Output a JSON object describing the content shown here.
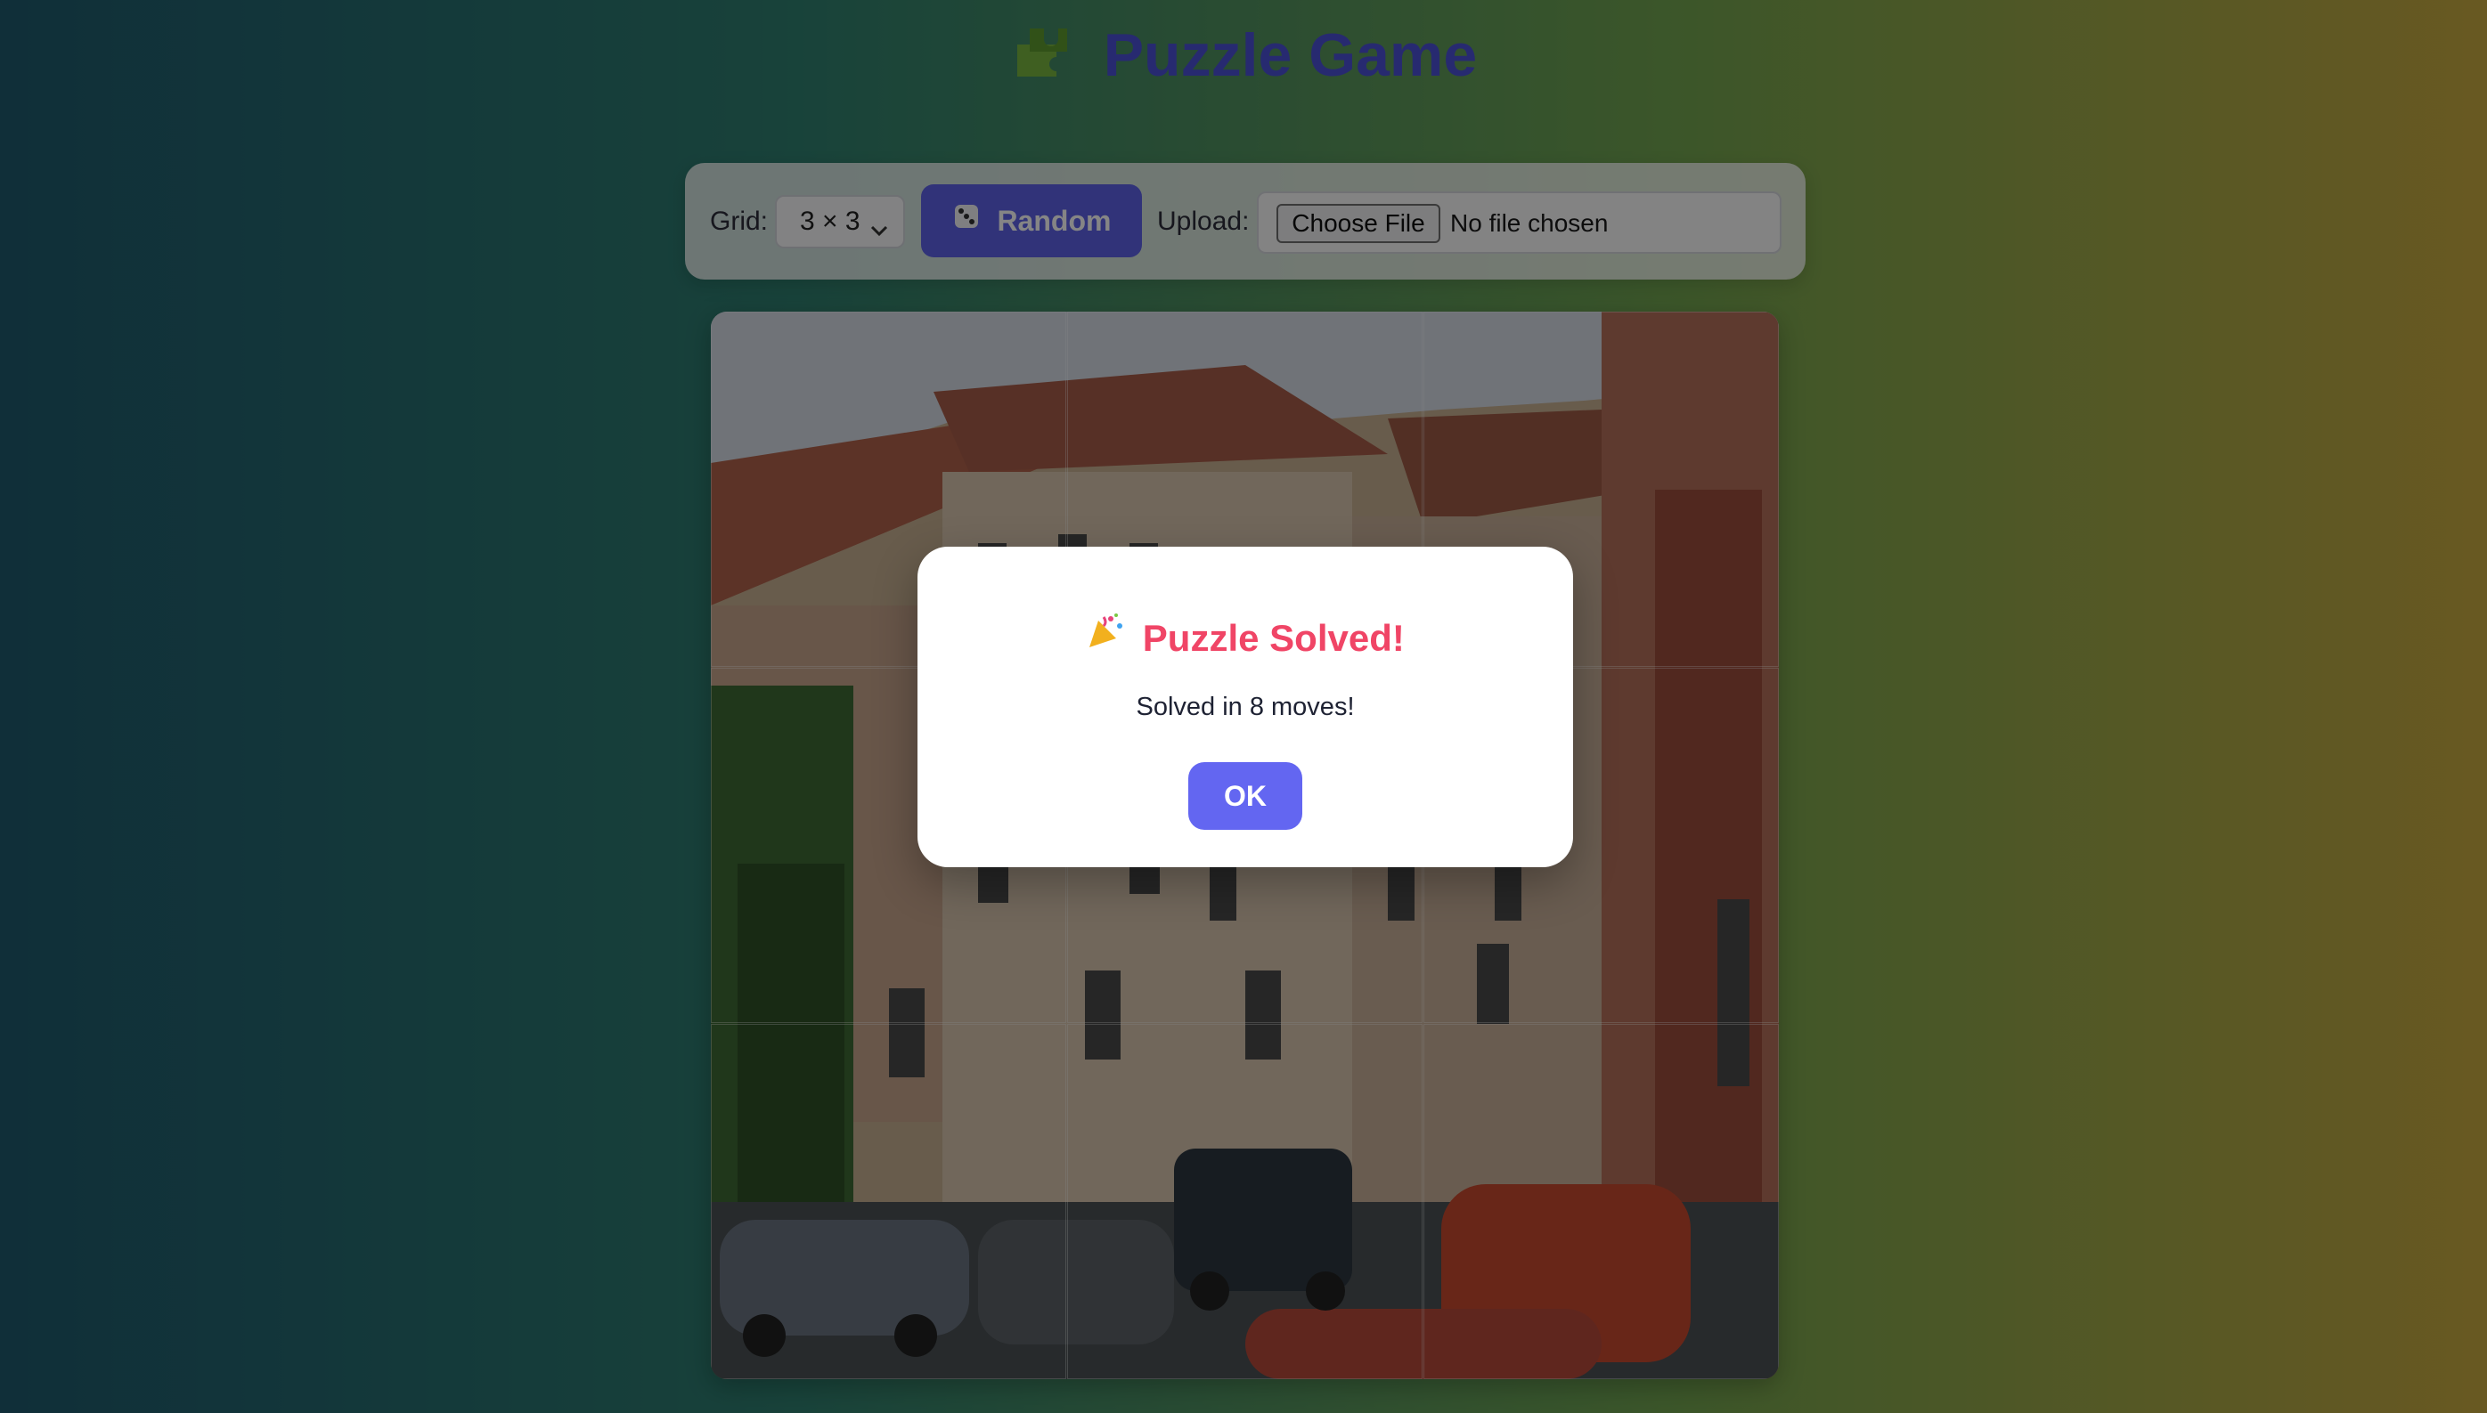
{
  "app": {
    "title": "Puzzle Game"
  },
  "controls": {
    "grid_label": "Grid:",
    "grid_value": "3 × 3",
    "random_label": "Random",
    "upload_label": "Upload:",
    "choose_file_label": "Choose File",
    "file_status": "No file chosen"
  },
  "board": {
    "rows": 3,
    "cols": 3
  },
  "dialog": {
    "title": "Puzzle Solved!",
    "message": "Solved in 8 moves!",
    "ok_label": "OK"
  },
  "colors": {
    "accent": "#6366f1",
    "title": "#4b51d6",
    "success_title": "#f04566"
  },
  "icons": {
    "title": "puzzle-icon",
    "random": "dice-icon",
    "dialog": "party-icon"
  }
}
